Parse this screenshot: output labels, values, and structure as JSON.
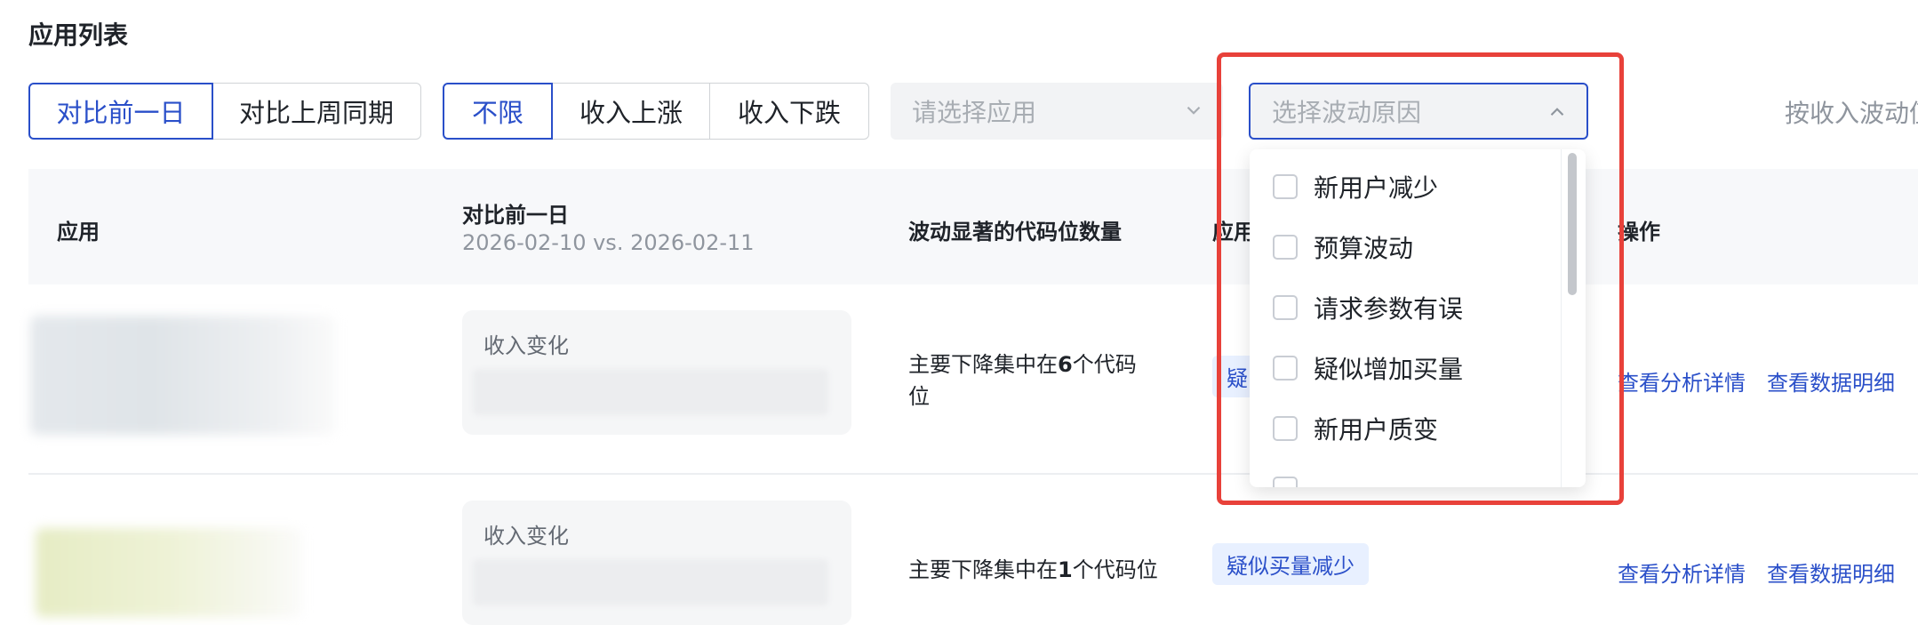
{
  "page_title": "应用列表",
  "compare_tabs": [
    "对比前一日",
    "对比上周同期"
  ],
  "trend_tabs": [
    "不限",
    "收入上涨",
    "收入下跌"
  ],
  "app_select": {
    "placeholder": "请选择应用"
  },
  "reason_select": {
    "placeholder": "选择波动原因",
    "options": [
      "新用户减少",
      "预算波动",
      "请求参数有误",
      "疑似增加买量",
      "新用户质变"
    ]
  },
  "sort_label": "按收入波动值",
  "table": {
    "headers": {
      "app": "应用",
      "compare": "对比前一日",
      "compare_dates": "2026-02-10 vs. 2026-02-11",
      "count": "波动显著的代码位数量",
      "reason": "应用",
      "actions": "操作"
    },
    "rows": [
      {
        "change_label": "收入变化",
        "desc_prefix": "主要下降集中在",
        "desc_num": "6",
        "desc_suffix": "个代码",
        "desc_line2": "位",
        "tag": "疑",
        "action1": "查看分析详情",
        "action2": "查看数据明细"
      },
      {
        "change_label": "收入变化",
        "desc_prefix": "主要下降集中在",
        "desc_num": "1",
        "desc_suffix": "个代码位",
        "tag": "疑似买量减少",
        "action1": "查看分析详情",
        "action2": "查看数据明细"
      }
    ]
  },
  "colors": {
    "accent": "#2a4fc9",
    "annotation": "#e8413a",
    "tag_bg": "#e8f0ff"
  }
}
